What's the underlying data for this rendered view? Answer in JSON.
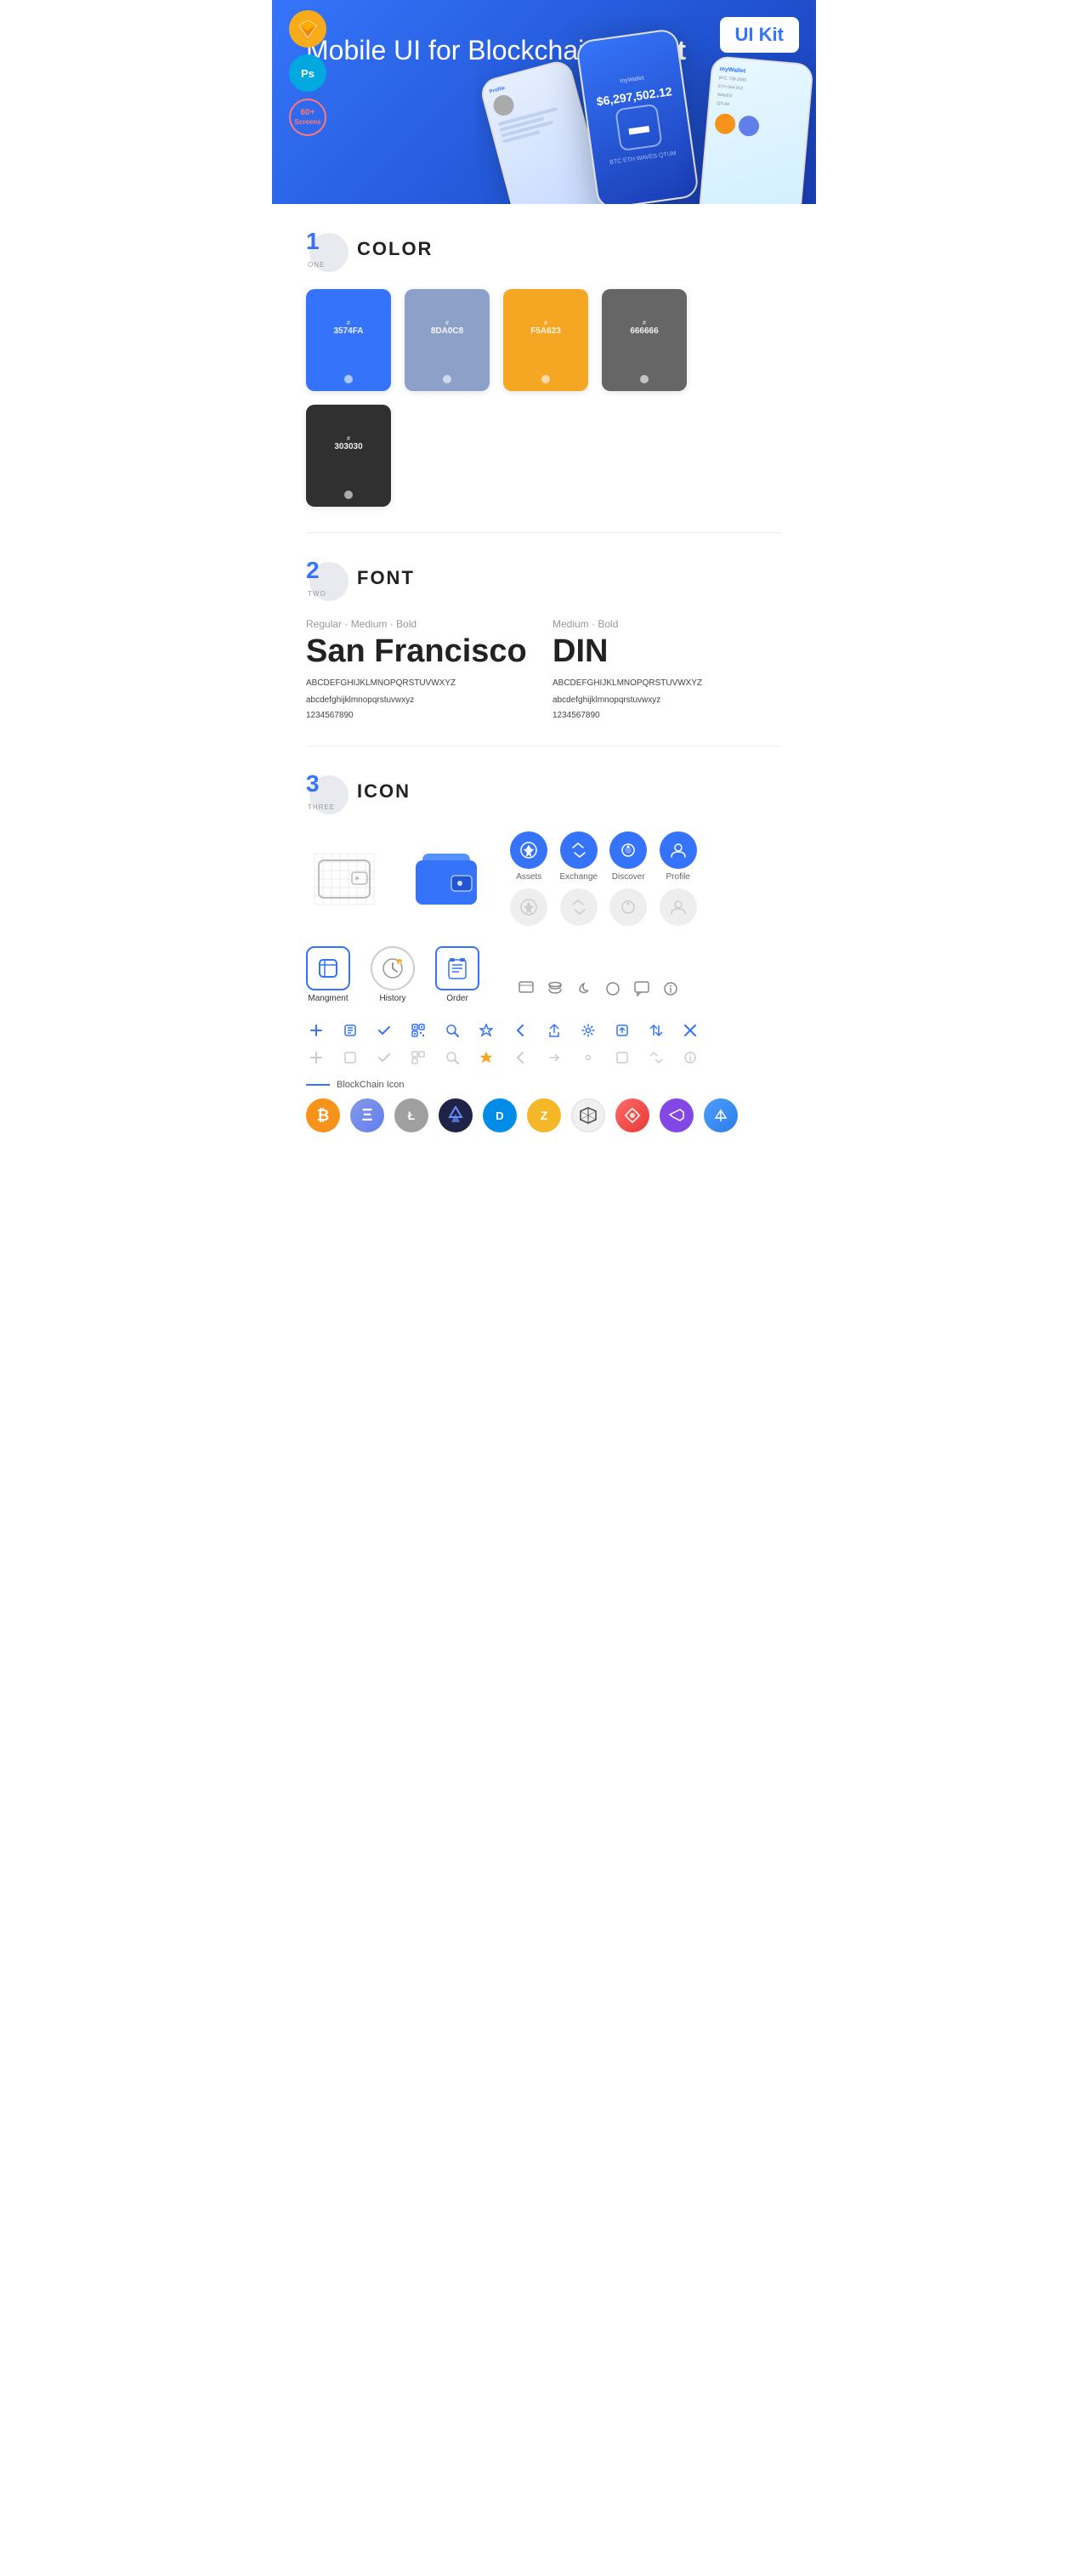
{
  "hero": {
    "title_regular": "Mobile UI for Blockchain ",
    "title_bold": "Wallet",
    "badge": "UI Kit",
    "tool_sketch": "S",
    "tool_ps": "Ps",
    "screens_count": "60+",
    "screens_label": "Screens"
  },
  "sections": {
    "color": {
      "number": "1",
      "sub": "ONE",
      "title": "COLOR",
      "swatches": [
        {
          "hex": "3574FA",
          "color": "#3574FA"
        },
        {
          "hex": "8DA0C8",
          "color": "#8DA0C8"
        },
        {
          "hex": "F5A623",
          "color": "#F5A623"
        },
        {
          "hex": "666666",
          "color": "#666666"
        },
        {
          "hex": "303030",
          "color": "#303030"
        }
      ]
    },
    "font": {
      "number": "2",
      "sub": "TWO",
      "title": "FONT",
      "fonts": [
        {
          "meta": "Regular · Medium · Bold",
          "name": "San Francisco",
          "style": "sf",
          "uppercase": "ABCDEFGHIJKLMNOPQRSTUVWXYZ",
          "lowercase": "abcdefghijklmnopqrstuvwxyz",
          "numbers": "1234567890"
        },
        {
          "meta": "Medium · Bold",
          "name": "DIN",
          "style": "din",
          "uppercase": "ABCDEFGHIJKLMNOPQRSTUVWXYZ",
          "lowercase": "abcdefghijklmnopqrstuvwxyz",
          "numbers": "1234567890"
        }
      ]
    },
    "icon": {
      "number": "3",
      "sub": "THREE",
      "title": "ICON",
      "named_icons": [
        {
          "label": "Assets"
        },
        {
          "label": "Exchange"
        },
        {
          "label": "Discover"
        },
        {
          "label": "Profile"
        }
      ],
      "bottom_icons": [
        {
          "label": "Mangment",
          "type": "box"
        },
        {
          "label": "History",
          "type": "clock"
        },
        {
          "label": "Order",
          "type": "list"
        }
      ],
      "blockchain_label": "BlockChain Icon",
      "crypto_coins": [
        {
          "symbol": "₿",
          "label": "BTC",
          "class": "coin-btc"
        },
        {
          "symbol": "Ξ",
          "label": "ETH",
          "class": "coin-eth"
        },
        {
          "symbol": "Ł",
          "label": "LTC",
          "class": "coin-ltc"
        },
        {
          "symbol": "◆",
          "label": "NIM",
          "class": "coin-nim"
        },
        {
          "symbol": "D",
          "label": "DASH",
          "class": "coin-dash"
        },
        {
          "symbol": "Z",
          "label": "ZEC",
          "class": "coin-zcash"
        },
        {
          "symbol": "⬡",
          "label": "IOTA",
          "class": "coin-iota"
        },
        {
          "symbol": "A",
          "label": "ARK",
          "class": "coin-ark"
        },
        {
          "symbol": "⬡",
          "label": "POL",
          "class": "coin-pol"
        },
        {
          "symbol": "~",
          "label": "MAT",
          "class": "coin-matic"
        }
      ]
    }
  }
}
